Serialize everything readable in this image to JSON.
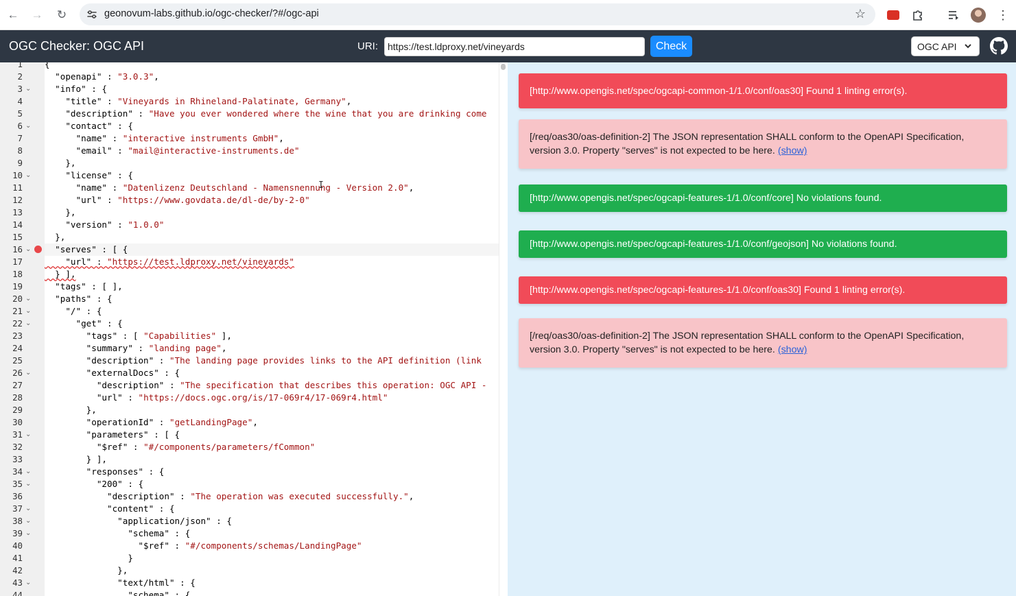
{
  "browser": {
    "url": "geonovum-labs.github.io/ogc-checker/?#/ogc-api",
    "icons": [
      "back-arrow-icon",
      "forward-arrow-icon",
      "reload-icon",
      "site-settings-icon",
      "star-icon",
      "extension-icon",
      "puzzle-icon",
      "media-controls-icon",
      "profile-avatar",
      "more-menu-icon"
    ],
    "glyphs": {
      "back": "←",
      "forward": "→",
      "reload": "↻",
      "star": "☆",
      "menu": "⋮"
    }
  },
  "header": {
    "title": "OGC Checker: OGC API",
    "uri_label": "URI:",
    "uri_value": "https://test.ldproxy.net/vineyards",
    "check_label": "Check",
    "api_select": "OGC API"
  },
  "editor": {
    "active_line": 16,
    "error_line": 16,
    "lines": [
      {
        "n": "1",
        "fold": false,
        "text": "{"
      },
      {
        "n": "2",
        "fold": false,
        "text": "  \"openapi\" : \"3.0.3\","
      },
      {
        "n": "3",
        "fold": true,
        "text": "  \"info\" : {"
      },
      {
        "n": "4",
        "fold": false,
        "text": "    \"title\" : \"Vineyards in Rhineland-Palatinate, Germany\","
      },
      {
        "n": "5",
        "fold": false,
        "text": "    \"description\" : \"Have you ever wondered where the wine that you are drinking come"
      },
      {
        "n": "6",
        "fold": true,
        "text": "    \"contact\" : {"
      },
      {
        "n": "7",
        "fold": false,
        "text": "      \"name\" : \"interactive instruments GmbH\","
      },
      {
        "n": "8",
        "fold": false,
        "text": "      \"email\" : \"mail@interactive-instruments.de\""
      },
      {
        "n": "9",
        "fold": false,
        "text": "    },"
      },
      {
        "n": "10",
        "fold": true,
        "text": "    \"license\" : {"
      },
      {
        "n": "11",
        "fold": false,
        "text": "      \"name\" : \"Datenlizenz Deutschland - Namensnennung - Version 2.0\","
      },
      {
        "n": "12",
        "fold": false,
        "text": "      \"url\" : \"https://www.govdata.de/dl-de/by-2-0\""
      },
      {
        "n": "13",
        "fold": false,
        "text": "    },"
      },
      {
        "n": "14",
        "fold": false,
        "text": "    \"version\" : \"1.0.0\""
      },
      {
        "n": "15",
        "fold": false,
        "text": "  },"
      },
      {
        "n": "16",
        "fold": true,
        "text": "  \"serves\" : [ {"
      },
      {
        "n": "17",
        "fold": false,
        "text": "    \"url\" : \"https://test.ldproxy.net/vineyards\""
      },
      {
        "n": "18",
        "fold": false,
        "text": "  } ],"
      },
      {
        "n": "19",
        "fold": false,
        "text": "  \"tags\" : [ ],"
      },
      {
        "n": "20",
        "fold": true,
        "text": "  \"paths\" : {"
      },
      {
        "n": "21",
        "fold": true,
        "text": "    \"/\" : {"
      },
      {
        "n": "22",
        "fold": true,
        "text": "      \"get\" : {"
      },
      {
        "n": "23",
        "fold": false,
        "text": "        \"tags\" : [ \"Capabilities\" ],"
      },
      {
        "n": "24",
        "fold": false,
        "text": "        \"summary\" : \"landing page\","
      },
      {
        "n": "25",
        "fold": false,
        "text": "        \"description\" : \"The landing page provides links to the API definition (link"
      },
      {
        "n": "26",
        "fold": true,
        "text": "        \"externalDocs\" : {"
      },
      {
        "n": "27",
        "fold": false,
        "text": "          \"description\" : \"The specification that describes this operation: OGC API -"
      },
      {
        "n": "28",
        "fold": false,
        "text": "          \"url\" : \"https://docs.ogc.org/is/17-069r4/17-069r4.html\""
      },
      {
        "n": "29",
        "fold": false,
        "text": "        },"
      },
      {
        "n": "30",
        "fold": false,
        "text": "        \"operationId\" : \"getLandingPage\","
      },
      {
        "n": "31",
        "fold": true,
        "text": "        \"parameters\" : [ {"
      },
      {
        "n": "32",
        "fold": false,
        "text": "          \"$ref\" : \"#/components/parameters/fCommon\""
      },
      {
        "n": "33",
        "fold": false,
        "text": "        } ],"
      },
      {
        "n": "34",
        "fold": true,
        "text": "        \"responses\" : {"
      },
      {
        "n": "35",
        "fold": true,
        "text": "          \"200\" : {"
      },
      {
        "n": "36",
        "fold": false,
        "text": "            \"description\" : \"The operation was executed successfully.\","
      },
      {
        "n": "37",
        "fold": true,
        "text": "            \"content\" : {"
      },
      {
        "n": "38",
        "fold": true,
        "text": "              \"application/json\" : {"
      },
      {
        "n": "39",
        "fold": true,
        "text": "                \"schema\" : {"
      },
      {
        "n": "40",
        "fold": false,
        "text": "                  \"$ref\" : \"#/components/schemas/LandingPage\""
      },
      {
        "n": "41",
        "fold": false,
        "text": "                }"
      },
      {
        "n": "42",
        "fold": false,
        "text": "              },"
      },
      {
        "n": "43",
        "fold": true,
        "text": "              \"text/html\" : {"
      },
      {
        "n": "44",
        "fold": false,
        "text": "                \"schema\" : {"
      }
    ]
  },
  "results": [
    {
      "type": "error",
      "text": "[http://www.opengis.net/spec/ogcapi-common-1/1.0/conf/oas30] Found 1 linting error(s).",
      "link": ""
    },
    {
      "type": "detail",
      "text": "[/req/oas30/oas-definition-2] The JSON representation SHALL conform to the OpenAPI Specification, version 3.0. Property \"serves\" is not expected to be here.",
      "link": "(show)"
    },
    {
      "type": "ok",
      "text": "[http://www.opengis.net/spec/ogcapi-features-1/1.0/conf/core] No violations found.",
      "link": ""
    },
    {
      "type": "ok",
      "text": "[http://www.opengis.net/spec/ogcapi-features-1/1.0/conf/geojson] No violations found.",
      "link": ""
    },
    {
      "type": "error",
      "text": "[http://www.opengis.net/spec/ogcapi-features-1/1.0/conf/oas30] Found 1 linting error(s).",
      "link": ""
    },
    {
      "type": "detail",
      "text": "[/req/oas30/oas-definition-2] The JSON representation SHALL conform to the OpenAPI Specification, version 3.0. Property \"serves\" is not expected to be here.",
      "link": "(show)"
    }
  ],
  "colors": {
    "header_bg": "#2e3743",
    "check_button": "#1a8cff",
    "error": "#f14b58",
    "detail": "#f8c4c8",
    "ok": "#1fae4f",
    "results_bg": "#dff0fb",
    "json_string": "#a31515"
  }
}
